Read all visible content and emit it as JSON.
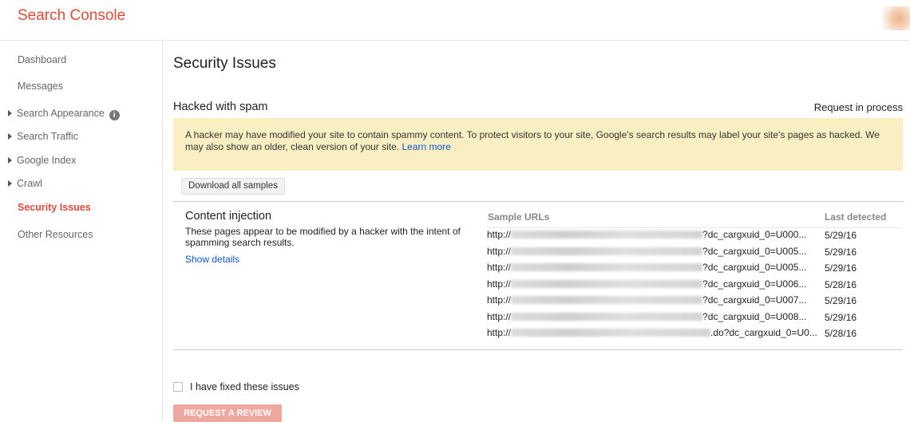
{
  "header": {
    "brand": "Search Console"
  },
  "sidebar": {
    "items": [
      {
        "label": "Dashboard"
      },
      {
        "label": "Messages"
      },
      {
        "label": "Search Appearance"
      },
      {
        "label": "Search Traffic"
      },
      {
        "label": "Google Index"
      },
      {
        "label": "Crawl"
      },
      {
        "label": "Security Issues"
      },
      {
        "label": "Other Resources"
      }
    ],
    "info_glyph": "i"
  },
  "main": {
    "title": "Security Issues",
    "issue_type": "Hacked with spam",
    "status": "Request in process",
    "warning": {
      "text": "A hacker may have modified your site to contain spammy content. To protect visitors to your site, Google's search results may label your site's pages as hacked. We may also show an older, clean version of your site.",
      "link": "Learn more"
    },
    "download_button": "Download all samples",
    "issue": {
      "name": "Content injection",
      "description": "These pages appear to be modified by a hacker with the intent of spamming search results.",
      "show_details": "Show details",
      "col_urls": "Sample URLs",
      "col_date": "Last detected",
      "rows": [
        {
          "prefix": "http://",
          "suffix": "?dc_cargxuid_0=U000...",
          "date": "5/29/16"
        },
        {
          "prefix": "http://",
          "suffix": "?dc_cargxuid_0=U005...",
          "date": "5/29/16"
        },
        {
          "prefix": "http://",
          "suffix": "?dc_cargxuid_0=U005...",
          "date": "5/29/16"
        },
        {
          "prefix": "http://",
          "suffix": "?dc_cargxuid_0=U006...",
          "date": "5/28/16"
        },
        {
          "prefix": "http://",
          "suffix": "?dc_cargxuid_0=U007...",
          "date": "5/29/16"
        },
        {
          "prefix": "http://",
          "suffix": "?dc_cargxuid_0=U008...",
          "date": "5/29/16"
        },
        {
          "prefix": "http://",
          "suffix": ".do?dc_cargxuid_0=U0...",
          "date": "5/28/16"
        }
      ]
    },
    "fixed_label": "I have fixed these issues",
    "review_button": "REQUEST A REVIEW"
  },
  "colors": {
    "brand": "#dd4b39",
    "link": "#1155cc",
    "warning_bg": "#f9efc3",
    "review_button": "#eda99f"
  }
}
